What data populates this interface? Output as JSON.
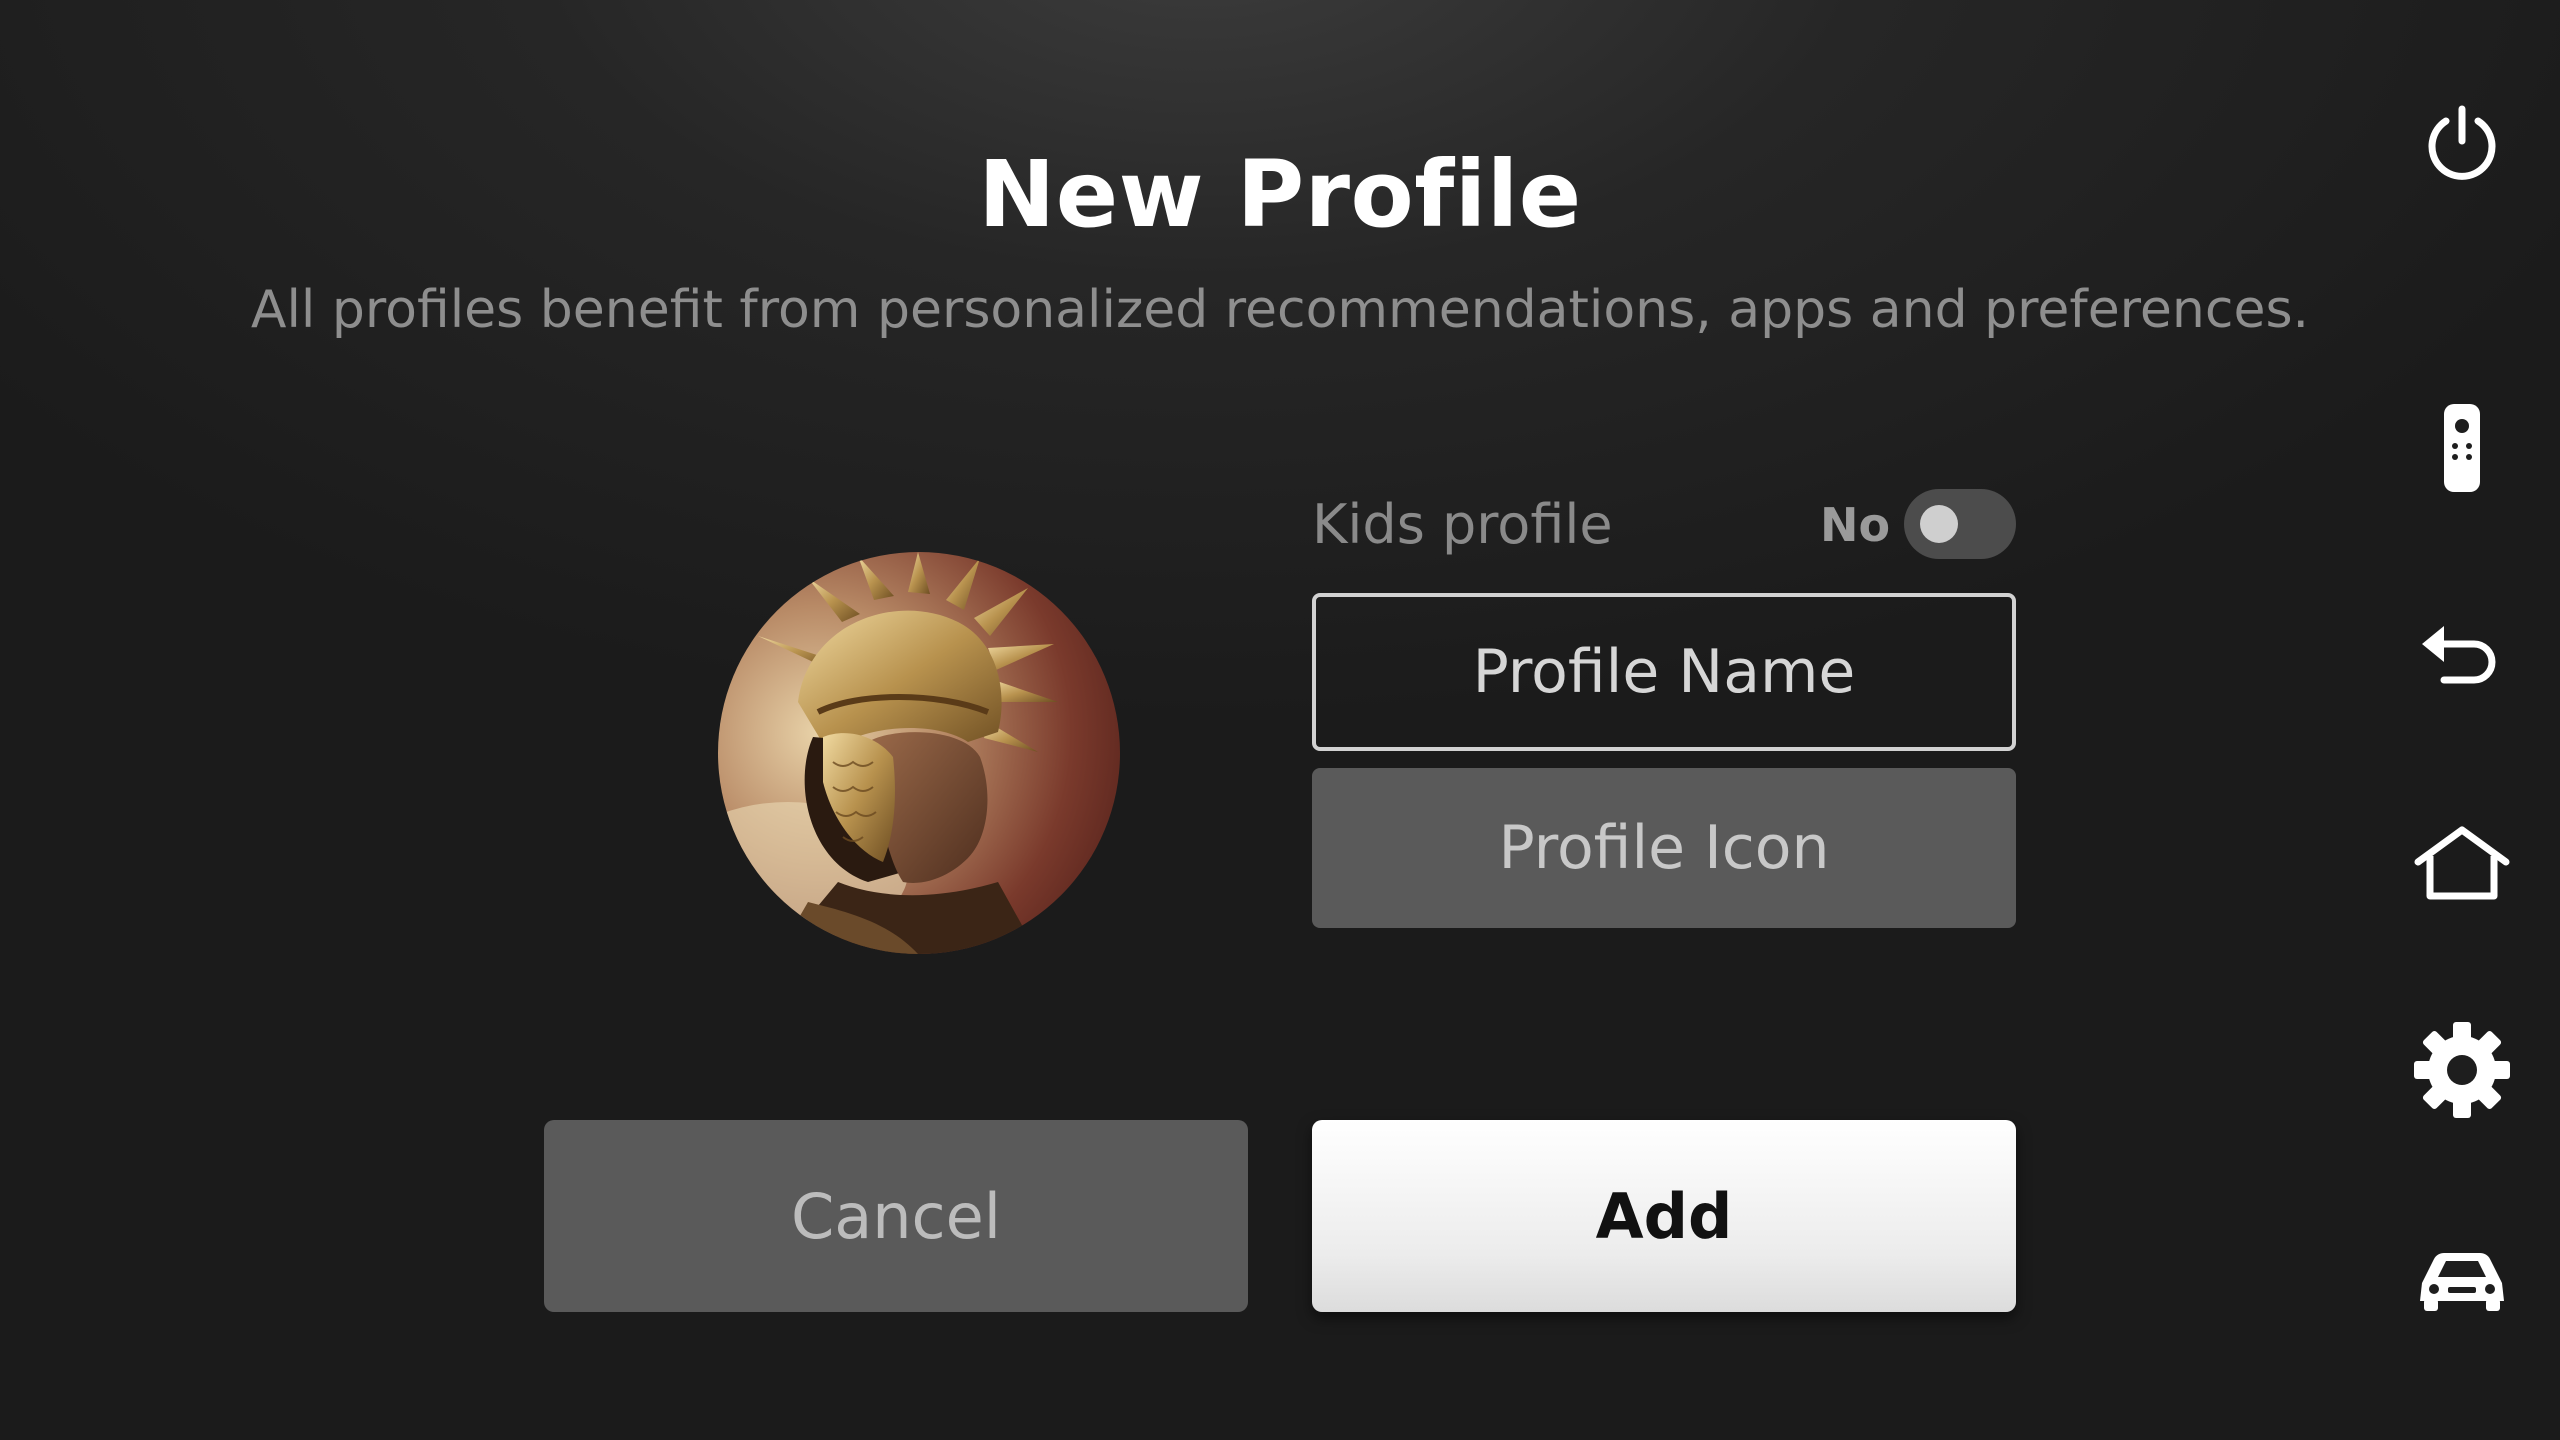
{
  "header": {
    "title": "New Profile",
    "subtitle": "All profiles benefit from personalized recommendations, apps and preferences."
  },
  "form": {
    "kids_profile_label": "Kids profile",
    "kids_profile_value": "No",
    "kids_profile_enabled": false,
    "profile_name_placeholder": "Profile Name",
    "profile_icon_label": "Profile Icon",
    "avatar_icon": "warrior-helmet-avatar"
  },
  "actions": {
    "cancel_label": "Cancel",
    "add_label": "Add"
  },
  "sidebar": {
    "icons": [
      "power-icon",
      "remote-icon",
      "back-icon",
      "home-icon",
      "settings-icon",
      "car-icon"
    ]
  },
  "colors": {
    "background": "#1b1b1b",
    "primary_button": "#ffffff",
    "secondary_button": "#5a5a5a",
    "muted_text": "#8e8e8e"
  }
}
